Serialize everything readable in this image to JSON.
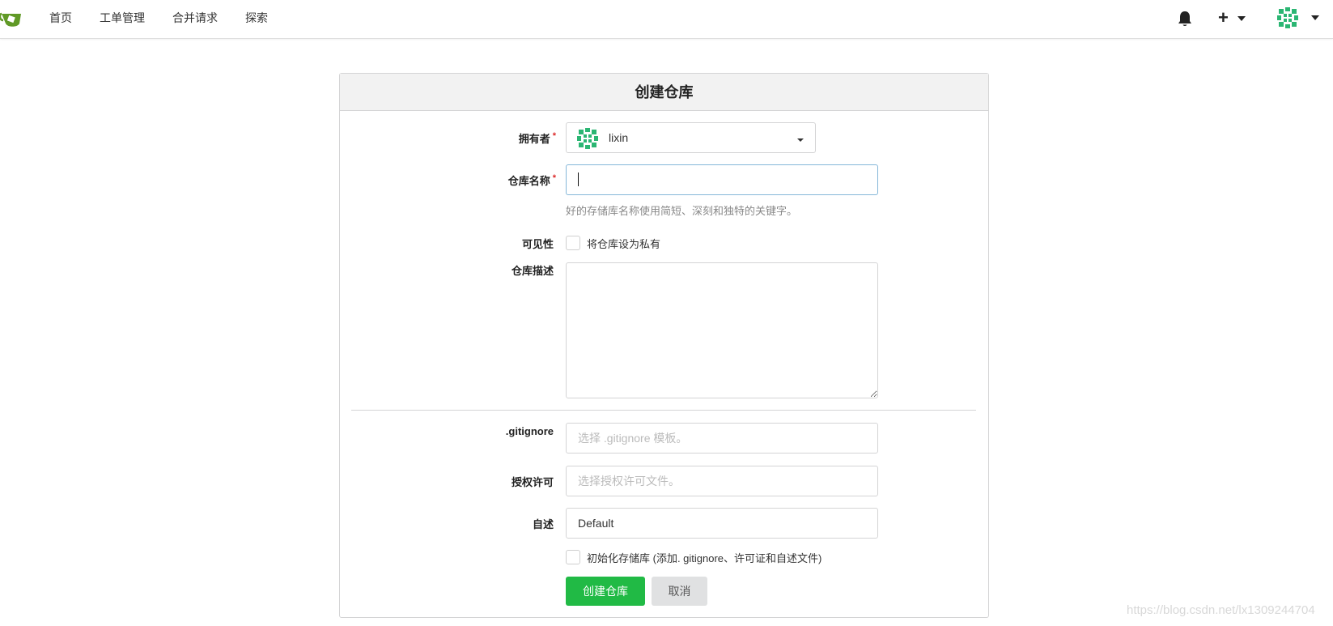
{
  "nav": {
    "links": [
      "首页",
      "工单管理",
      "合并请求",
      "探索"
    ],
    "logo_icon": "gitea-teapot-logo",
    "bell_icon": "bell-icon",
    "plus_icon": "plus-icon",
    "user_avatar_icon": "identicon-avatar"
  },
  "form": {
    "title": "创建仓库",
    "owner": {
      "label": "拥有者",
      "value": "lixin"
    },
    "repo_name": {
      "label": "仓库名称",
      "value": "",
      "help": "好的存储库名称使用简短、深刻和独特的关键字。"
    },
    "visibility": {
      "label": "可见性",
      "checkbox_label": "将仓库设为私有",
      "checked": false
    },
    "description": {
      "label": "仓库描述",
      "value": ""
    },
    "gitignore": {
      "label": ".gitignore",
      "placeholder": "选择 .gitignore 模板。"
    },
    "license": {
      "label": "授权许可",
      "placeholder": "选择授权许可文件。"
    },
    "readme": {
      "label": "自述",
      "value": "Default"
    },
    "auto_init": {
      "label": "初始化存储库 (添加. gitignore、许可证和自述文件)",
      "checked": false
    },
    "required_mark": "*",
    "submit_label": "创建仓库",
    "cancel_label": "取消"
  },
  "colors": {
    "primary_green": "#21ba45",
    "required_red": "#db2828",
    "avatar_green": "#2bb673"
  },
  "watermark": "https://blog.csdn.net/lx1309244704"
}
